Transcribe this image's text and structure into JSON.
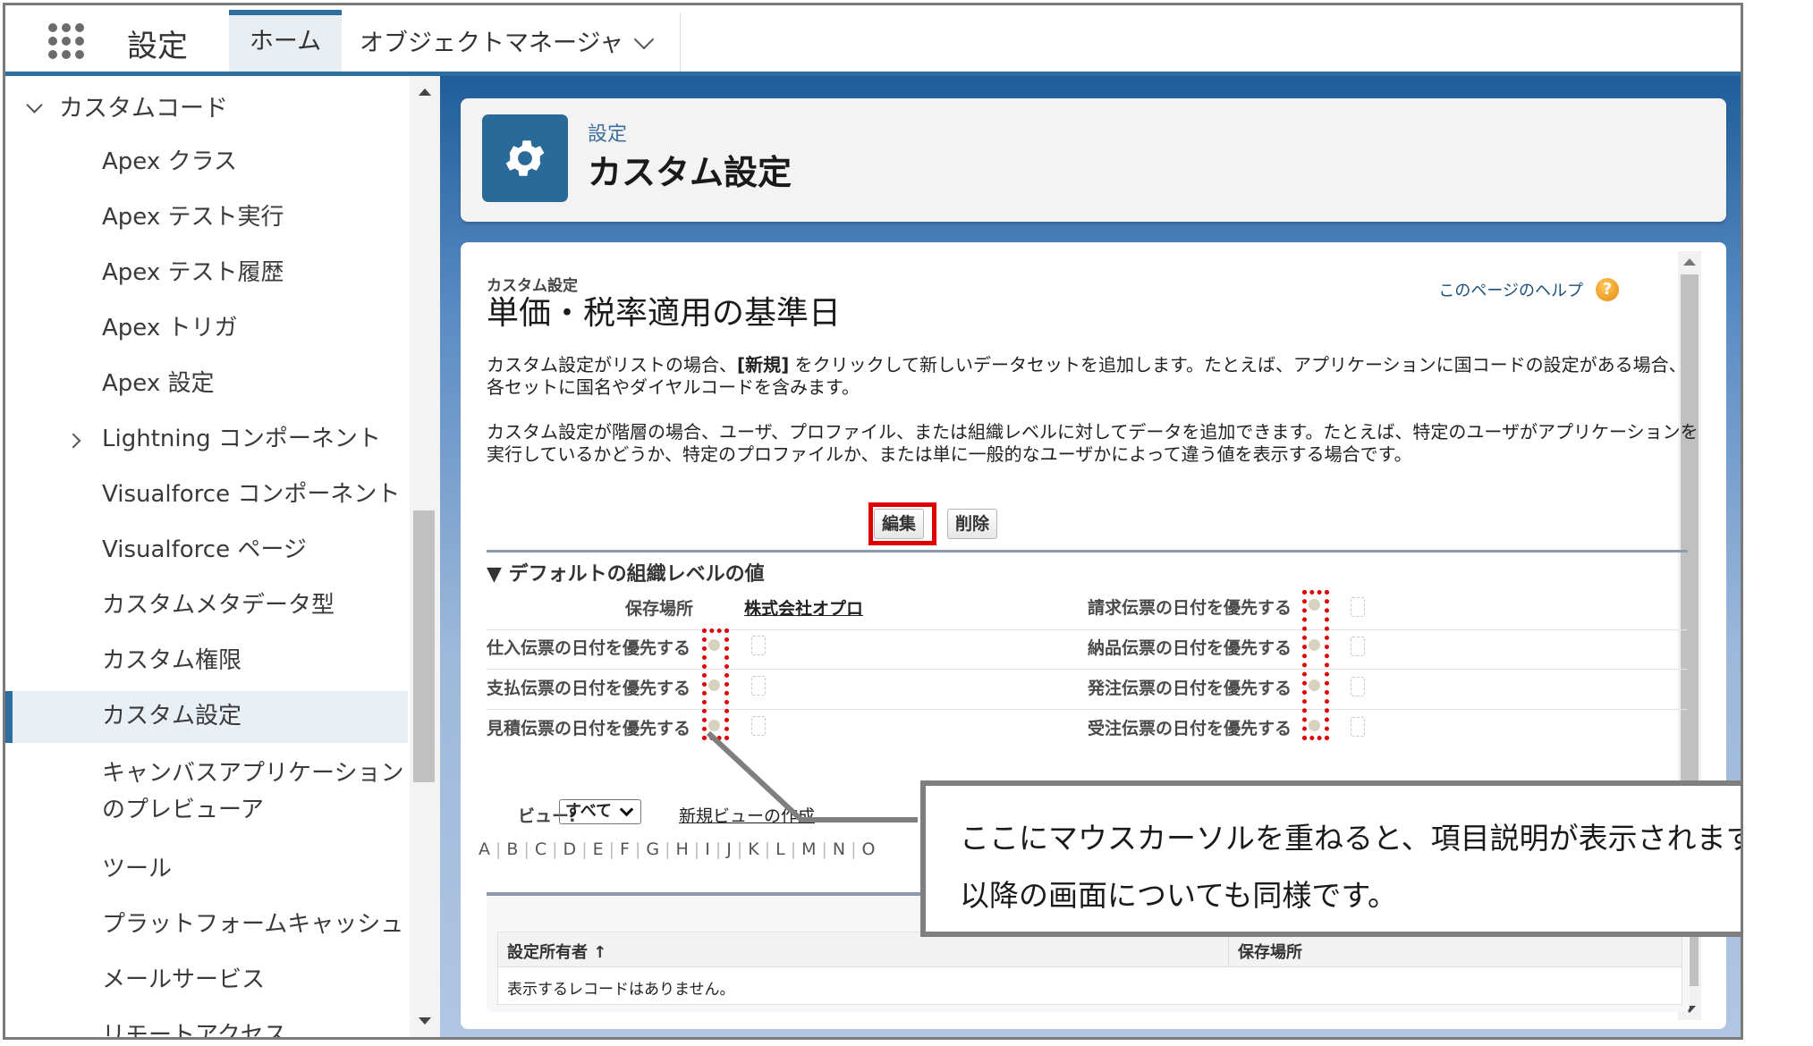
{
  "topbar": {
    "app_launcher_icon": "app-launcher-grid-icon",
    "app_name": "設定",
    "tabs": [
      {
        "label": "ホーム",
        "active": true
      },
      {
        "label": "オブジェクトマネージャ",
        "active": false,
        "has_dropdown": true
      }
    ]
  },
  "sidebar": {
    "section": {
      "label": "カスタムコード",
      "expanded": true
    },
    "items": [
      {
        "label": "Apex クラス"
      },
      {
        "label": "Apex テスト実行"
      },
      {
        "label": "Apex テスト履歴"
      },
      {
        "label": "Apex トリガ"
      },
      {
        "label": "Apex 設定"
      },
      {
        "label": "Lightning コンポーネント",
        "collapsible": true
      },
      {
        "label": "Visualforce コンポーネント"
      },
      {
        "label": "Visualforce ページ"
      },
      {
        "label": "カスタムメタデータ型"
      },
      {
        "label": "カスタム権限"
      },
      {
        "label": "カスタム設定",
        "selected": true
      },
      {
        "label": "キャンバスアプリケーション",
        "label2": "のプレビューア"
      },
      {
        "label": "ツール"
      },
      {
        "label": "プラットフォームキャッシュ"
      },
      {
        "label": "メールサービス"
      },
      {
        "label": "リモートアクセス"
      }
    ]
  },
  "header": {
    "icon": "gear-icon",
    "subtitle": "設定",
    "title": "カスタム設定"
  },
  "main": {
    "kicker": "カスタム設定",
    "title": "単価・税率適用の基準日",
    "help_link": "このページのヘルプ",
    "desc1_pre": "カスタム設定がリストの場合、",
    "desc1_bold": "[新規]",
    "desc1_post": " をクリックして新しいデータセットを追加します。たとえば、アプリケーションに国コードの設定がある場合、各セットに国名やダイヤルコードを含みます。",
    "desc2": "カスタム設定が階層の場合、ユーザ、プロファイル、または組織レベルに対してデータを追加できます。たとえば、特定のユーザがアプリケーションを実行しているかどうか、特定のプロファイルか、または単に一般的なユーザかによって違う値を表示する場合です。",
    "buttons": {
      "edit": "編集",
      "delete": "削除"
    },
    "section_title": "▼ デフォルトの組織レベルの値",
    "location_label": "保存場所",
    "location_value": "株式会社オプロ",
    "fields_left": [
      {
        "label": "仕入伝票の日付を優先する",
        "checked": false
      },
      {
        "label": "支払伝票の日付を優先する",
        "checked": false
      },
      {
        "label": "見積伝票の日付を優先する",
        "checked": false
      }
    ],
    "fields_right": [
      {
        "label": "請求伝票の日付を優先する",
        "checked": false
      },
      {
        "label": "納品伝票の日付を優先する",
        "checked": false
      },
      {
        "label": "発注伝票の日付を優先する",
        "checked": false
      },
      {
        "label": "受注伝票の日付を優先する",
        "checked": false
      }
    ],
    "view": {
      "label": "ビュー:",
      "selected": "すべて",
      "new_view_link": "新規ビューの作成"
    },
    "alphabet": [
      "A",
      "B",
      "C",
      "D",
      "E",
      "F",
      "G",
      "H",
      "I",
      "J",
      "K",
      "L",
      "M",
      "N",
      "O"
    ],
    "table": {
      "columns": [
        "設定所有者 ↑",
        "保存場所"
      ],
      "empty_message": "表示するレコードはありません。"
    }
  },
  "callout": {
    "line1": "ここにマウスカーソルを重ねると、項目説明が表示されます。",
    "line2": "以降の画面についても同様です。"
  },
  "colors": {
    "brand_blue": "#2d6e9e",
    "highlight_red": "#e00000",
    "callout_border": "#7f7f7f"
  }
}
